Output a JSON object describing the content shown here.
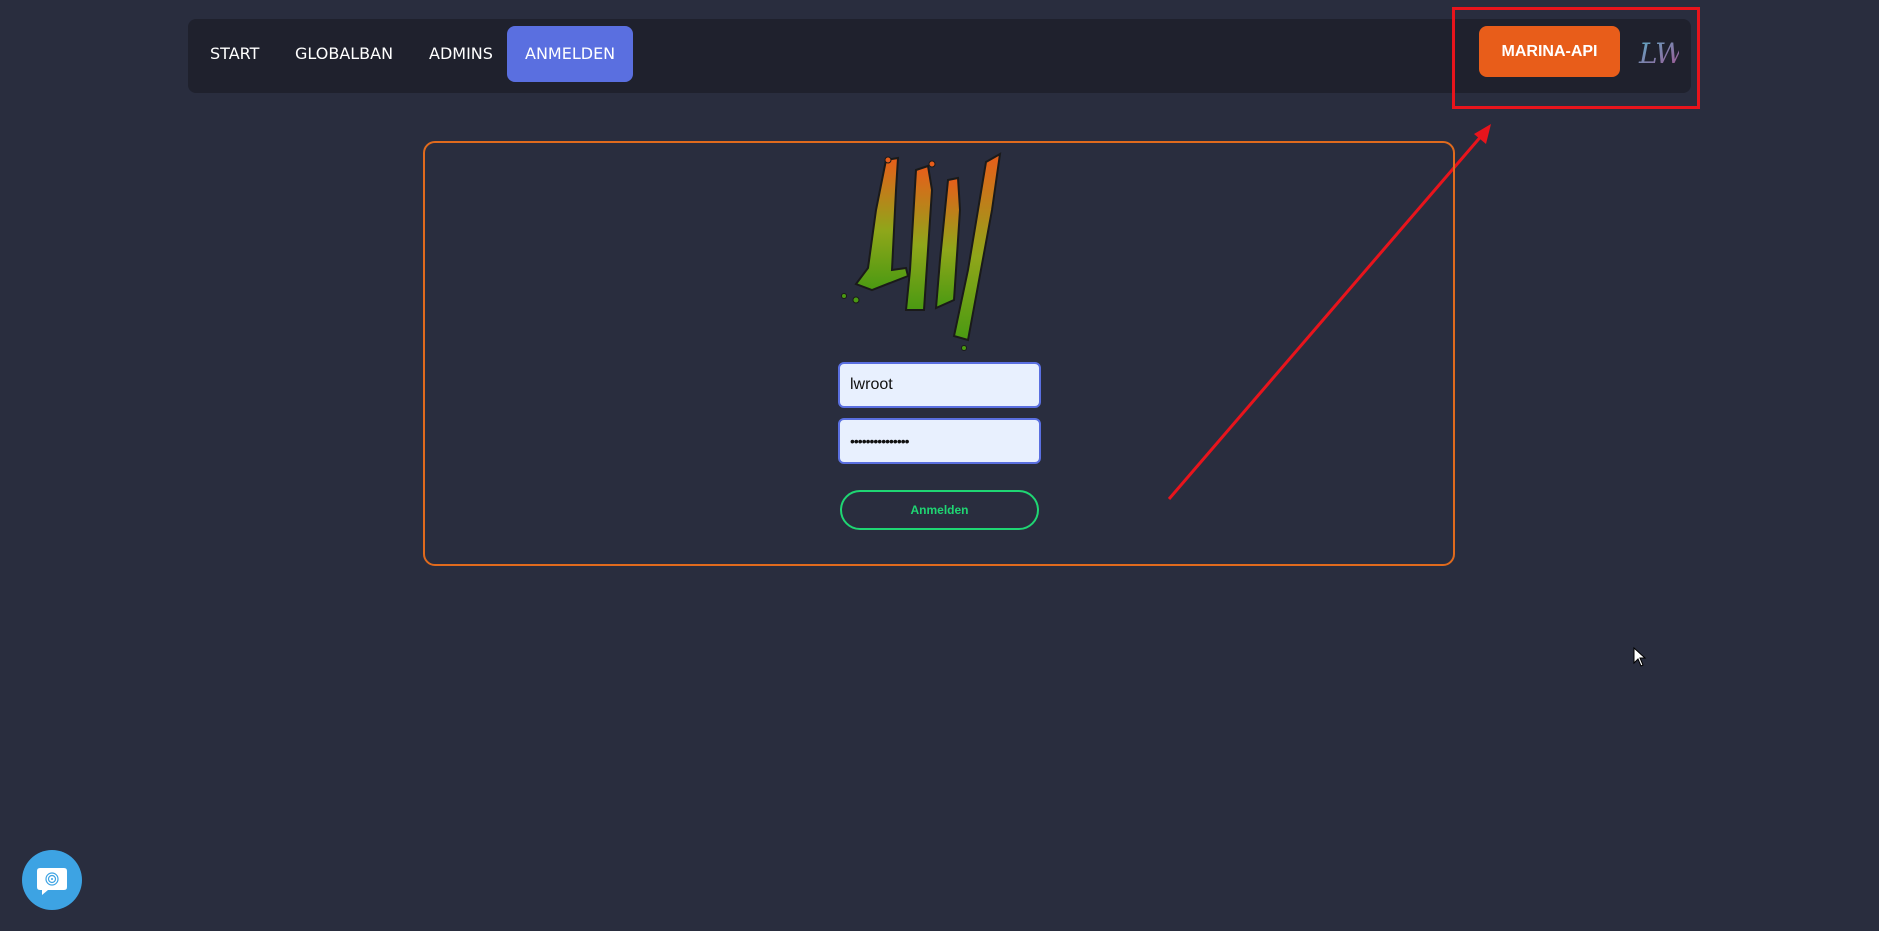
{
  "nav": {
    "items": [
      {
        "label": "START",
        "active": false
      },
      {
        "label": "GLOBALBAN",
        "active": false
      },
      {
        "label": "ADMINS",
        "active": false
      },
      {
        "label": "ANMELDEN",
        "active": true
      }
    ],
    "api_button_label": "MARINA-API",
    "logo_text": "LW"
  },
  "login": {
    "logo_text": "LW",
    "username_value": "lwroot",
    "password_value": "•••••••••••••••",
    "submit_label": "Anmelden"
  },
  "annotation": {
    "highlight_color": "#e8141c"
  },
  "colors": {
    "background": "#292d3e",
    "navbar": "#1f212d",
    "nav_active": "#5a6fe0",
    "api_button": "#e85d1a",
    "card_border": "#e06a1d",
    "submit_accent": "#1fd673",
    "chat_button": "#3da3e3"
  },
  "icons": {
    "chat": "fingerprint-chat-icon",
    "cursor": "mouse-pointer-icon"
  }
}
